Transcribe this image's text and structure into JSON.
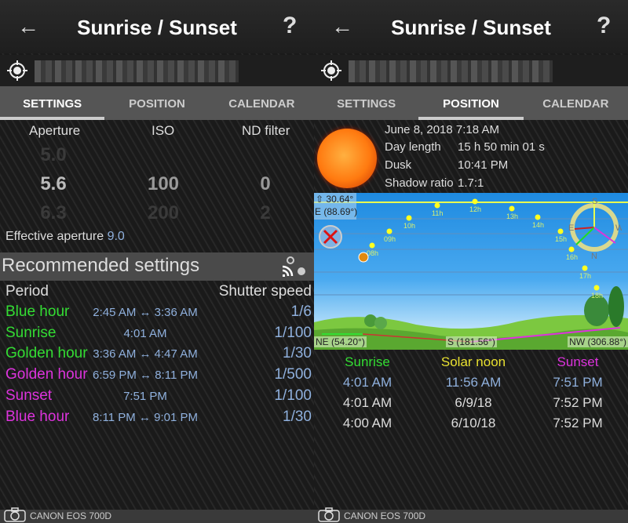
{
  "app": {
    "title": "Sunrise / Sunset",
    "back_icon": "arrow-left-icon",
    "help_icon": "question-icon",
    "location_icon": "crosshair-icon"
  },
  "tabs": [
    "SETTINGS",
    "POSITION",
    "CALENDAR"
  ],
  "settings": {
    "columns": [
      "Aperture",
      "ISO",
      "ND filter"
    ],
    "aperture": {
      "prev": "5.0",
      "value": "5.6",
      "next": "6.3"
    },
    "iso": {
      "prev": "",
      "value": "100",
      "next": "200"
    },
    "nd": {
      "prev": "",
      "value": "0",
      "next": "2"
    },
    "effective_label": "Effective aperture",
    "effective_value": "9.0",
    "recommended_title": "Recommended settings",
    "period_header": "Period",
    "shutter_header": "Shutter speed",
    "rows": [
      {
        "period": "Blue hour",
        "time": "2:45 AM ↔ 3:36 AM",
        "shutter": "1/6",
        "color": "#33dd33"
      },
      {
        "period": "Sunrise",
        "time": "4:01 AM",
        "shutter": "1/100",
        "color": "#33dd33"
      },
      {
        "period": "Golden hour",
        "time": "3:36 AM ↔ 4:47 AM",
        "shutter": "1/30",
        "color": "#33dd33"
      },
      {
        "period": "Golden hour",
        "time": "6:59 PM ↔ 8:11 PM",
        "shutter": "1/500",
        "color": "#dd33dd"
      },
      {
        "period": "Sunset",
        "time": "7:51 PM",
        "shutter": "1/100",
        "color": "#dd33dd"
      },
      {
        "period": "Blue hour",
        "time": "8:11 PM ↔ 9:01 PM",
        "shutter": "1/30",
        "color": "#dd33dd"
      }
    ]
  },
  "position": {
    "datetime": "June 8, 2018 7:18 AM",
    "day_length_label": "Day length",
    "day_length": "15 h 50 min 01 s",
    "dusk_label": "Dusk",
    "dusk": "10:41 PM",
    "shadow_label": "Shadow ratio",
    "shadow": "1.7:1",
    "elevation": "⇧ 30.64°",
    "azimuth": "E (88.69°)",
    "hours": [
      "08h",
      "09h",
      "10h",
      "11h",
      "12h",
      "13h",
      "14h",
      "15h",
      "16h",
      "17h",
      "18h"
    ],
    "compass": [
      "S",
      "E",
      "W",
      "N"
    ],
    "bottom_labels": [
      "NE (54.20°)",
      "S (181.56°)",
      "NW (306.88°)"
    ],
    "table_headers": [
      {
        "text": "Sunrise",
        "color": "#33dd33"
      },
      {
        "text": "Solar noon",
        "color": "#e8e030"
      },
      {
        "text": "Sunset",
        "color": "#dd33dd"
      }
    ],
    "table_rows": [
      [
        "4:01 AM",
        "11:56 AM",
        "7:51 PM"
      ],
      [
        "4:01 AM",
        "6/9/18",
        "7:52 PM"
      ],
      [
        "4:00 AM",
        "6/10/18",
        "7:52 PM"
      ]
    ]
  },
  "footer": {
    "camera": "CANON EOS 700D"
  }
}
